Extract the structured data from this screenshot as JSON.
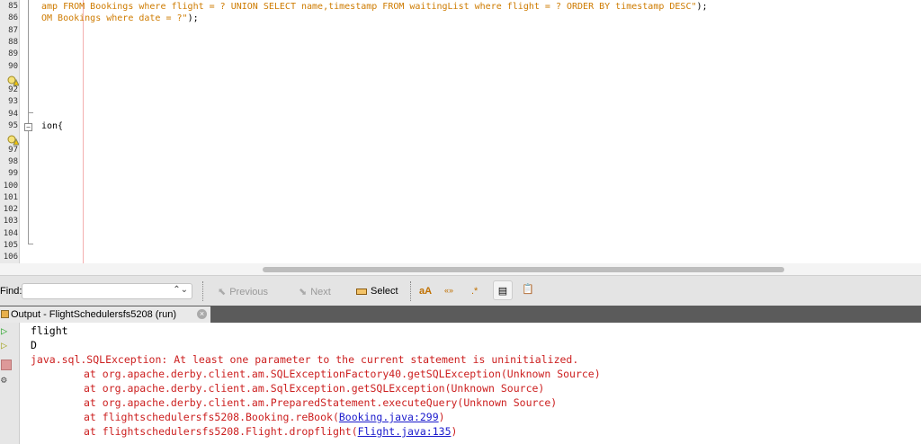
{
  "editor": {
    "line_numbers": [
      "85",
      "86",
      "87",
      "88",
      "89",
      "90",
      "",
      "92",
      "93",
      "94",
      "95",
      "",
      "97",
      "98",
      "99",
      "100",
      "101",
      "102",
      "103",
      "104",
      "105",
      "106"
    ],
    "lines": {
      "l85": "amp FROM Bookings where flight = ? UNION SELECT name,timestamp FROM waitingList where flight = ? ORDER BY timestamp DESC\"",
      "l85_end": ");",
      "l86": "OM Bookings where date = ?\"",
      "l86_end": ");",
      "l95": "ion{"
    }
  },
  "findbar": {
    "label": "Find:",
    "value": "",
    "previous": "Previous",
    "next": "Next",
    "select": "Select"
  },
  "output": {
    "tab_title": "Output - FlightSchedulersfs5208 (run)",
    "lines": [
      {
        "text": "flight"
      },
      {
        "text": "D"
      },
      {
        "text": "java.sql.SQLException: At least one parameter to the current statement is uninitialized."
      },
      {
        "text": "at org.apache.derby.client.am.SQLExceptionFactory40.getSQLException(Unknown Source)"
      },
      {
        "text": "at org.apache.derby.client.am.SqlException.getSQLException(Unknown Source)"
      },
      {
        "text": "at org.apache.derby.client.am.PreparedStatement.executeQuery(Unknown Source)"
      },
      {
        "text": "at flightschedulersfs5208.Booking.reBook(",
        "link": "Booking.java:299",
        "end": ")"
      },
      {
        "text": "at flightschedulersfs5208.Flight.dropflight(",
        "link": "Flight.java:135",
        "end": ")"
      }
    ]
  },
  "colors": {
    "string": "#ce7b00",
    "error": "#cc1f1f",
    "link": "#1a1acc"
  }
}
